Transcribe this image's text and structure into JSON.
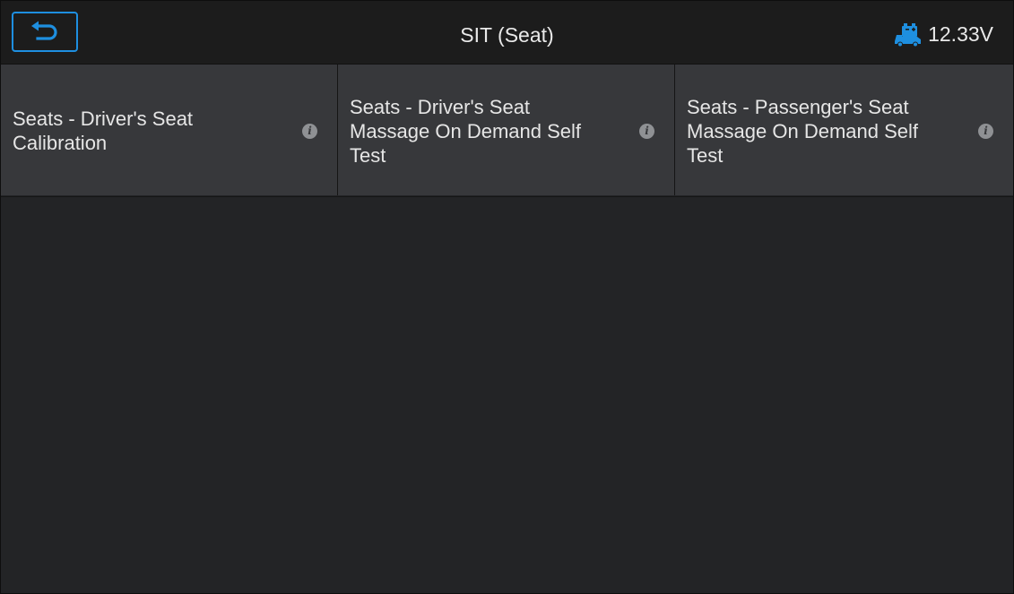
{
  "header": {
    "title": "SIT (Seat)",
    "voltage": "12.33V",
    "back_icon": "back-arrow-icon",
    "battery_icon": "vehicle-battery-icon"
  },
  "colors": {
    "accent": "#1e8fe0",
    "header_bg": "#1c1c1c",
    "tile_bg": "#37383b",
    "content_bg": "#232426"
  },
  "tiles": [
    {
      "label": "Seats - Driver's Seat\nCalibration",
      "icon": "info-icon",
      "info": "i"
    },
    {
      "label": "Seats - Driver's Seat\nMassage On Demand Self\nTest",
      "icon": "info-icon",
      "info": "i"
    },
    {
      "label": "Seats - Passenger's Seat\nMassage On Demand Self\nTest",
      "icon": "info-icon",
      "info": "i"
    }
  ]
}
